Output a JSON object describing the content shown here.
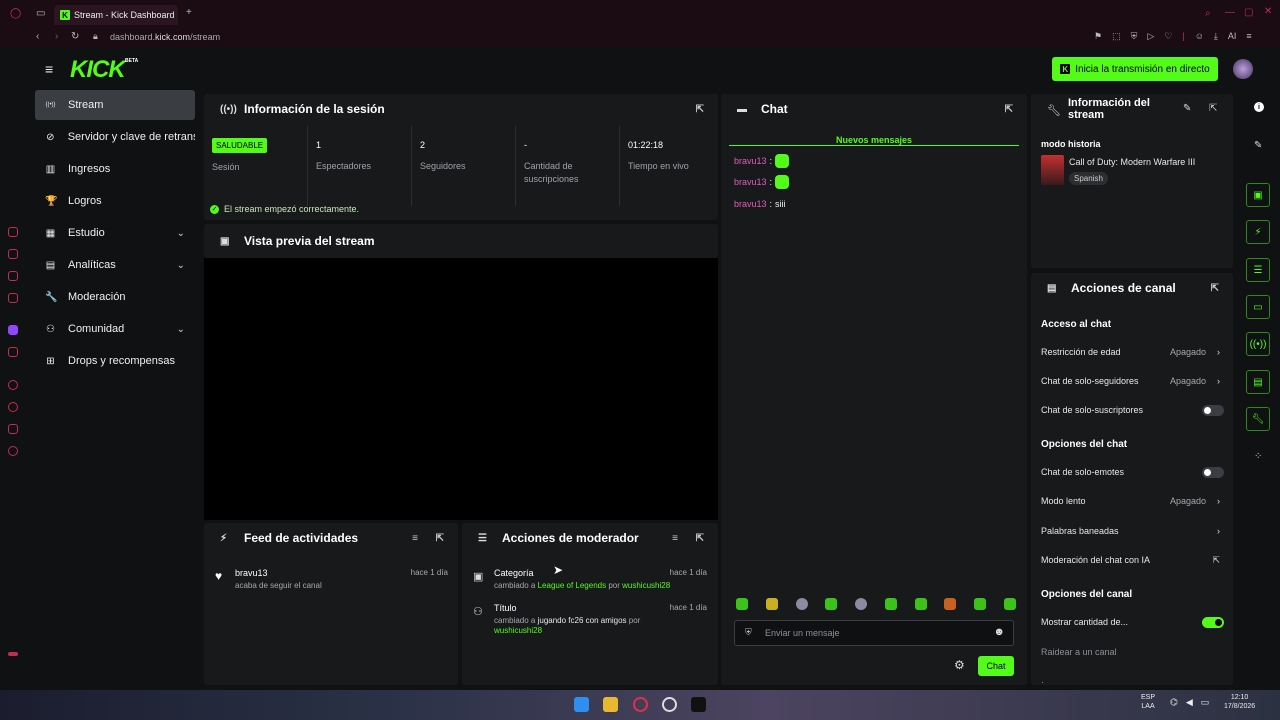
{
  "browser": {
    "tab_title": "Stream - Kick Dashboard",
    "new_tab": "+",
    "url_prefix": "dashboard.",
    "url_domain": "kick.com",
    "url_path": "/stream",
    "ai_label": "AI"
  },
  "header": {
    "logo": "KICK",
    "beta": "BETA",
    "go_live_label": "Inicia la transmisión en directo"
  },
  "sidebar": {
    "items": [
      {
        "label": "Stream",
        "icon": "broadcast-icon",
        "glyph": "((•))",
        "active": true
      },
      {
        "label": "Servidor y clave de retrans",
        "icon": "link-icon",
        "glyph": "⊘"
      },
      {
        "label": "Ingresos",
        "icon": "chart-icon",
        "glyph": "▥"
      },
      {
        "label": "Logros",
        "icon": "trophy-icon",
        "glyph": "🏆"
      },
      {
        "label": "Estudio",
        "icon": "studio-icon",
        "glyph": "▦",
        "expand": true
      },
      {
        "label": "Analíticas",
        "icon": "analytics-icon",
        "glyph": "▤",
        "expand": true
      },
      {
        "label": "Moderación",
        "icon": "wrench-icon",
        "glyph": "🔧"
      },
      {
        "label": "Comunidad",
        "icon": "community-icon",
        "glyph": "⚇",
        "expand": true
      },
      {
        "label": "Drops y recompensas",
        "icon": "drops-icon",
        "glyph": "⊞"
      }
    ]
  },
  "session": {
    "title": "Información de la sesión",
    "status_badge": "SALUDABLE",
    "stats": [
      {
        "value": "",
        "label": "Sesión"
      },
      {
        "value": "1",
        "label": "Espectadores"
      },
      {
        "value": "2",
        "label": "Seguidores"
      },
      {
        "value": "-",
        "label": "Cantidad de suscripciones"
      },
      {
        "value": "01:22:18",
        "label": "Tiempo en vivo"
      }
    ],
    "success_message": "El stream empezó correctamente."
  },
  "preview": {
    "title": "Vista previa del stream"
  },
  "activity_feed": {
    "title": "Feed de actividades",
    "items": [
      {
        "user": "bravu13",
        "text": "acaba de seguir el canal",
        "time": "hace 1 día"
      }
    ]
  },
  "mod_actions": {
    "title": "Acciones de moderador",
    "items": [
      {
        "title": "Categoría",
        "prefix": "cambiado a ",
        "target": "League of Legends",
        "by": " por ",
        "user": "wushicushi28",
        "time": "hace 1 día"
      },
      {
        "title": "Título",
        "prefix": "cambiado a ",
        "target": "jugando fc26 con amigos",
        "by": " por",
        "user": "wushicushi28",
        "time": "hace 1 día"
      }
    ]
  },
  "chat": {
    "title": "Chat",
    "new_messages": "Nuevos mensajes",
    "messages": [
      {
        "user": "bravu13",
        "text": "",
        "emote": true
      },
      {
        "user": "bravu13",
        "text": "",
        "emote": true
      },
      {
        "user": "bravu13",
        "text": "siii",
        "emote": false
      }
    ],
    "placeholder": "Enviar un mensaje",
    "send_label": "Chat"
  },
  "stream_info": {
    "title": "Información del stream",
    "stream_title": "modo historia",
    "game": "Call of Duty: Modern Warfare III",
    "language": "Spanish"
  },
  "channel_actions": {
    "title": "Acciones de canal",
    "sections": [
      {
        "heading": "Acceso al chat"
      },
      {
        "heading": "Opciones del chat"
      },
      {
        "heading": "Opciones del canal"
      }
    ],
    "rows": [
      {
        "label": "Restricción de edad",
        "value": "Apagado",
        "kind": "arrow"
      },
      {
        "label": "Chat de solo-seguidores",
        "value": "Apagado",
        "kind": "arrow"
      },
      {
        "label": "Chat de solo-suscriptores",
        "value": "",
        "kind": "toggle-off"
      },
      {
        "label": "Chat de solo-emotes",
        "value": "",
        "kind": "toggle-off"
      },
      {
        "label": "Modo lento",
        "value": "Apagado",
        "kind": "arrow"
      },
      {
        "label": "Palabras baneadas",
        "value": "",
        "kind": "arrow"
      },
      {
        "label": "Moderación del chat con IA",
        "value": "",
        "kind": "external"
      },
      {
        "label": "Mostrar cantidad de...",
        "value": "",
        "kind": "toggle-on"
      },
      {
        "label": "Raidear a un canal",
        "value": "",
        "kind": "dim"
      }
    ]
  },
  "taskbar": {
    "lang_top": "ESP",
    "lang_bottom": "LAA",
    "time": "12:10",
    "date": "17/8/2026"
  },
  "colors": {
    "accent": "#53fc18",
    "bg": "#0f1112",
    "panel": "#18191b",
    "username": "#e35cbd"
  }
}
